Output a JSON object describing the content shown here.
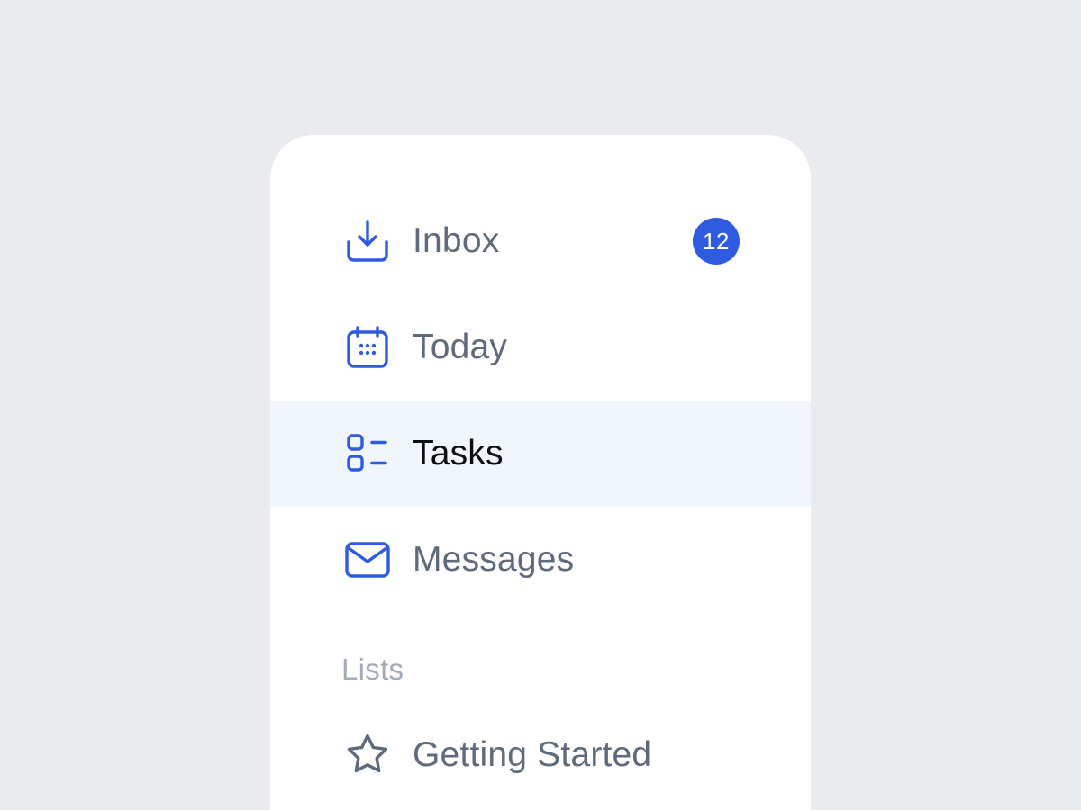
{
  "colors": {
    "background": "#E9EBEF",
    "panel": "#FFFFFF",
    "accent": "#2F5BE0",
    "active_row": "#F1F6FD",
    "label": "#5F6A7A",
    "label_active": "#0B0D12",
    "section_heading": "#A3ABB8",
    "list_icon": "#5F6A7A"
  },
  "nav": {
    "items": [
      {
        "label": "Inbox",
        "icon": "inbox-download-icon",
        "badge": "12",
        "active": false
      },
      {
        "label": "Today",
        "icon": "calendar-icon",
        "active": false
      },
      {
        "label": "Tasks",
        "icon": "task-list-icon",
        "active": true
      },
      {
        "label": "Messages",
        "icon": "envelope-icon",
        "active": false
      }
    ]
  },
  "lists": {
    "heading": "Lists",
    "items": [
      {
        "label": "Getting Started",
        "icon": "star-icon"
      }
    ]
  }
}
